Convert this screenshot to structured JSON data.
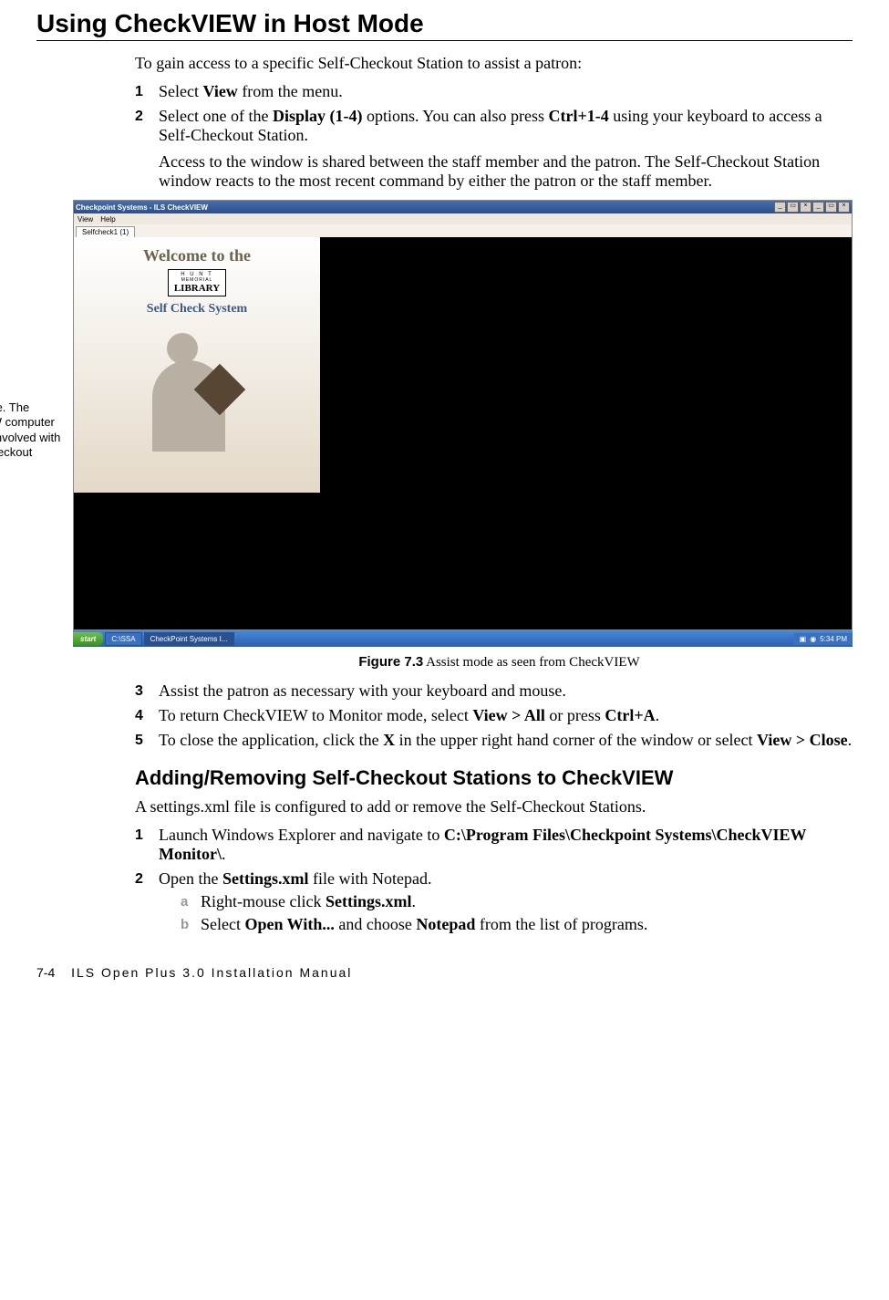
{
  "title": "Using CheckVIEW in Host Mode",
  "intro": "To gain access to a specific Self-Checkout Station to assist a patron:",
  "steps_top": {
    "s1": {
      "n": "1",
      "t1": "Select ",
      "b1": "View",
      "t2": " from the menu."
    },
    "s2": {
      "n": "2",
      "t1": "Select one of the ",
      "b1": "Display (1-4)",
      "t2": " options. You can also press ",
      "b2": "Ctrl+1-4",
      "t3": " using your keyboard to access a Self-Checkout Station."
    }
  },
  "para1": "Access to the window is shared between the staff member and the patron. The Self-Checkout Station window reacts to the most recent command by either the patron or the staff member.",
  "side_note": "Assist mode. The CheckVIEW computer is actively involved with the Self-Checkout Station.",
  "screenshot": {
    "win_title": "Checkpoint Systems - ILS CheckVIEW",
    "menu": {
      "view": "View",
      "help": "Help"
    },
    "tab": "Selfcheck1 (1)",
    "welcome": "Welcome to the",
    "logo": {
      "l1": "H U N T",
      "l2": "MEMORIAL",
      "l3": "LIBRARY"
    },
    "scs": "Self Check System",
    "taskbar": {
      "start": "start",
      "btn1": "C:\\SSA",
      "btn2": "CheckPoint Systems I...",
      "time": "5:34 PM"
    }
  },
  "figure": {
    "label": "Figure 7.3",
    "text": " Assist mode as seen from CheckVIEW"
  },
  "steps_bottom": {
    "s3": {
      "n": "3",
      "t": "Assist the patron as necessary with your keyboard and mouse."
    },
    "s4": {
      "n": "4",
      "t1": "To return CheckVIEW to Monitor mode, select ",
      "b1": "View > All",
      "t2": " or press ",
      "b2": "Ctrl+A",
      "t3": "."
    },
    "s5": {
      "n": "5",
      "t1": "To close the application, click the ",
      "b1": "X",
      "t2": " in the upper right hand corner of the window or select ",
      "b2": "View > Close",
      "t3": "."
    }
  },
  "h2": "Adding/Removing Self-Checkout Stations to CheckVIEW",
  "h2_intro": "A settings.xml file is configured to add or remove the Self-Checkout Stations.",
  "steps_add": {
    "s1": {
      "n": "1",
      "t1": "Launch Windows Explorer and navigate to ",
      "b1": "C:\\Program Files\\Checkpoint Systems\\CheckVIEW Monitor\\",
      "t2": "."
    },
    "s2": {
      "n": "2",
      "t1": "Open the ",
      "b1": "Settings.xml",
      "t2": " file with Notepad."
    },
    "sa": {
      "l": "a",
      "t1": "Right-mouse click ",
      "b1": "Settings.xml",
      "t2": "."
    },
    "sb": {
      "l": "b",
      "t1": "Select ",
      "b1": "Open With...",
      "t2": " and choose ",
      "b2": "Notepad",
      "t3": " from the list of programs."
    }
  },
  "footer": {
    "page": "7-4",
    "manual": "ILS Open Plus 3.0 Installation Manual"
  }
}
